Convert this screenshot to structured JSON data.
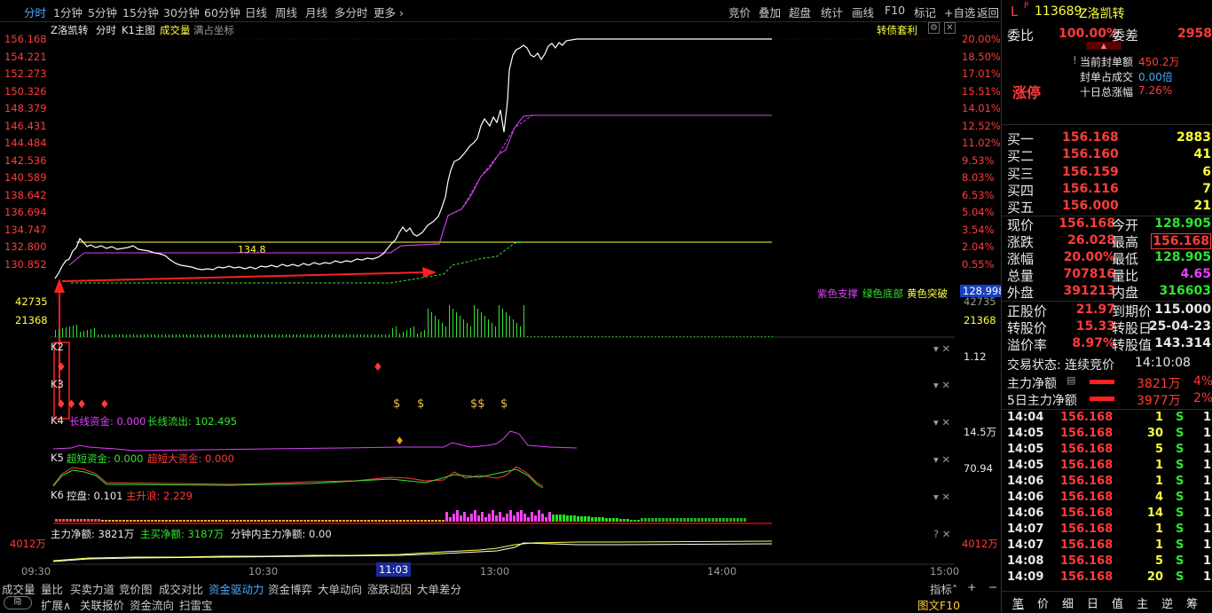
{
  "topbar": {
    "periods": [
      "分时",
      "1分钟",
      "5分钟",
      "15分钟",
      "30分钟",
      "60分钟",
      "日线",
      "周线",
      "月线",
      "多分时",
      "更多 ›"
    ],
    "tools": [
      "竞价",
      "叠加",
      "超盘",
      "统计",
      "画线",
      "F10",
      "标记",
      "+自选",
      "返回"
    ]
  },
  "chart": {
    "title": "Z洛凯转",
    "tabs": [
      "分时",
      "K1主图"
    ],
    "volume_label": "成交量",
    "full_coord": "满占坐标",
    "arb_label": "转债套利",
    "price_ticks": [
      "156.168",
      "154.221",
      "152.273",
      "150.326",
      "148.379",
      "146.431",
      "144.484",
      "142.536",
      "140.589",
      "138.642",
      "136.694",
      "134.747",
      "132.800",
      "130.852"
    ],
    "pct_ticks": [
      "20.00%",
      "18.50%",
      "17.01%",
      "15.51%",
      "14.01%",
      "12.52%",
      "11.02%",
      "9.53%",
      "8.03%",
      "6.53%",
      "5.04%",
      "3.54%",
      "2.04%",
      "0.55%"
    ],
    "vol_ticks": [
      "42735",
      "21368"
    ],
    "right_vol_ticks": [
      "42735",
      "21368"
    ],
    "yellow_line_label": "134.8",
    "current_price_box": "128.998",
    "legend": {
      "purple": "紫色支撑",
      "green": "绿色底部",
      "yellow": "黄色突破"
    },
    "k2": {
      "label": "K2",
      "right_value": "1.12"
    },
    "k3": {
      "label": "K3"
    },
    "k4": {
      "label": "K4",
      "long_in": "长线资金: 0.000",
      "long_out": "长线流出: 102.495",
      "right_value": "14.5万"
    },
    "k5": {
      "label": "K5",
      "super_short": "超短资金: 0.000",
      "super_big": "超短大资金: 0.000",
      "right_value": "70.94"
    },
    "k6": {
      "label": "K6",
      "control": "控盘: 0.101",
      "main_up": "主升浪: 2.229"
    },
    "k7": {
      "main_net": "主力净额: 3821万",
      "main_buy": "主买净额: 3187万",
      "minute_net": "分钟内主力净额: 0.00",
      "left_value": "4012万",
      "right_value": "4012万"
    },
    "time_ticks": [
      "09:30",
      "10:30",
      "11:03",
      "13:00",
      "14:00",
      "15:00"
    ],
    "indicator_label": "指标˄",
    "plus": "+",
    "minus": "−"
  },
  "bottombar": {
    "tabs": [
      "成交量",
      "量比",
      "买卖力道",
      "竞价图",
      "成交对比",
      "资金驱动力",
      "资金博弈",
      "大单动向",
      "涨跌动因",
      "大单差分"
    ],
    "active_tab": "资金驱动力",
    "row2": [
      "扩展∧",
      "关联报价",
      "资金流向",
      "扫雷宝"
    ],
    "toggle": "隐",
    "report": "图文F10"
  },
  "panel": {
    "flag": "L",
    "sup": "P",
    "code": "113689",
    "name": "Z洛凯转",
    "wei_bi_label": "委比",
    "wei_bi": "100.00%",
    "wei_cha_label": "委差",
    "wei_cha": "2958",
    "limit_up": "涨停",
    "seal_label": "当前封单额",
    "seal": "450.2万",
    "seal_ratio_label": "封单占成交",
    "seal_ratio": "0.00倍",
    "ten_day_label": "十日总涨幅",
    "ten_day": "7.26%",
    "bids": [
      {
        "label": "买一",
        "price": "156.168",
        "vol": "2883"
      },
      {
        "label": "买二",
        "price": "156.160",
        "vol": "41"
      },
      {
        "label": "买三",
        "price": "156.159",
        "vol": "6"
      },
      {
        "label": "买四",
        "price": "156.116",
        "vol": "7"
      },
      {
        "label": "买五",
        "price": "156.000",
        "vol": "21"
      }
    ],
    "quote": [
      {
        "l1": "现价",
        "v1": "156.168",
        "l2": "今开",
        "v2": "128.905"
      },
      {
        "l1": "涨跌",
        "v1": "26.028",
        "l2": "最高",
        "v2": "156.168"
      },
      {
        "l1": "涨幅",
        "v1": "20.00%",
        "l2": "最低",
        "v2": "128.905"
      },
      {
        "l1": "总量",
        "v1": "707816",
        "l2": "量比",
        "v2": "4.65"
      },
      {
        "l1": "外盘",
        "v1": "391213",
        "l2": "内盘",
        "v2": "316603"
      }
    ],
    "bond": [
      {
        "l1": "正股价",
        "v1": "21.97",
        "l2": "到期价",
        "v2": "115.000"
      },
      {
        "l1": "转股价",
        "v1": "15.33",
        "l2": "转股日",
        "v2": "25-04-23"
      },
      {
        "l1": "溢价率",
        "v1": "8.97%",
        "l2": "转股值",
        "v2": "143.314"
      }
    ],
    "trade_state": "交易状态: 连续竞价",
    "trade_time": "14:10:08",
    "main_net_label": "主力净额",
    "main_net": "3821万",
    "main_net_pct": "4%",
    "five_day_label": "5日主力净额",
    "five_day": "3977万",
    "five_day_pct": "2%",
    "ticks": [
      {
        "time": "14:04",
        "price": "156.168",
        "vol": "1",
        "side": "S",
        "n": "1"
      },
      {
        "time": "14:05",
        "price": "156.168",
        "vol": "30",
        "side": "S",
        "n": "1"
      },
      {
        "time": "14:05",
        "price": "156.168",
        "vol": "5",
        "side": "S",
        "n": "1"
      },
      {
        "time": "14:05",
        "price": "156.168",
        "vol": "1",
        "side": "S",
        "n": "1"
      },
      {
        "time": "14:06",
        "price": "156.168",
        "vol": "1",
        "side": "S",
        "n": "1"
      },
      {
        "time": "14:06",
        "price": "156.168",
        "vol": "4",
        "side": "S",
        "n": "1"
      },
      {
        "time": "14:06",
        "price": "156.168",
        "vol": "14",
        "side": "S",
        "n": "1"
      },
      {
        "time": "14:07",
        "price": "156.168",
        "vol": "1",
        "side": "S",
        "n": "1"
      },
      {
        "time": "14:07",
        "price": "156.168",
        "vol": "1",
        "side": "S",
        "n": "1"
      },
      {
        "time": "14:08",
        "price": "156.168",
        "vol": "5",
        "side": "S",
        "n": "1"
      },
      {
        "time": "14:09",
        "price": "156.168",
        "vol": "20",
        "side": "S",
        "n": "1"
      }
    ],
    "footer_tabs": [
      "笔",
      "价",
      "细",
      "日",
      "值",
      "主",
      "逆",
      "筹"
    ]
  },
  "colors": {
    "up": "#ff3b3b",
    "down": "#2ee62e",
    "flat": "#e8e8e8",
    "accent": "#4aa8ff",
    "yellow": "#ffff3c",
    "purple": "#e040fb"
  }
}
